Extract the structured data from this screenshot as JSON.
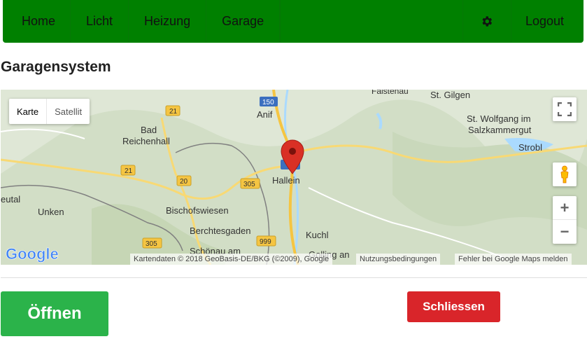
{
  "nav": {
    "items": [
      {
        "label": "Home"
      },
      {
        "label": "Licht"
      },
      {
        "label": "Heizung"
      },
      {
        "label": "Garage"
      }
    ],
    "logout_label": "Logout",
    "settings_icon": "gear-icon",
    "background": "#008000"
  },
  "page": {
    "title": "Garagensystem"
  },
  "map": {
    "type_karte": "Karte",
    "type_satellit": "Satellit",
    "places": {
      "faistenau": "Faistenau",
      "st_gilgen": "St. Gilgen",
      "anif": "Anif",
      "st_wolfgang": "St. Wolfgang im",
      "salzkammergut": "Salzkammergut",
      "bad": "Bad",
      "reichenhall": "Reichenhall",
      "strobl": "Strobl",
      "hallein": "Hallein",
      "eutal": "eutal",
      "unken": "Unken",
      "bischofswiesen": "Bischofswiesen",
      "berchtesgaden": "Berchtesgaden",
      "kuchl": "Kuchl",
      "schoenau": "Schönau am",
      "golling": "Golling an"
    },
    "roads": {
      "r150": "150",
      "r21a": "21",
      "r21b": "21",
      "r20": "20",
      "r305a": "305",
      "r305b": "305",
      "r999": "999"
    },
    "logo": "Google",
    "attribution": "Kartendaten © 2018 GeoBasis-DE/BKG (©2009), Google",
    "terms": "Nutzungsbedingungen",
    "report": "Fehler bei Google Maps melden",
    "zoom_in": "+",
    "zoom_out": "−",
    "marker_color": "#d93025"
  },
  "actions": {
    "open_label": "Öffnen",
    "close_label": "Schliessen",
    "open_color": "#2bb34a",
    "close_color": "#d9252a"
  }
}
